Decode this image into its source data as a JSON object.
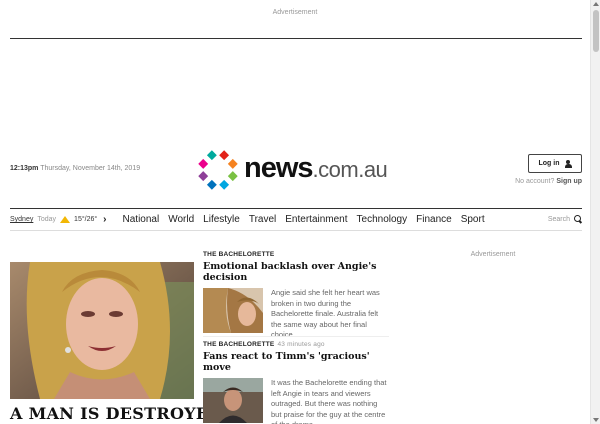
{
  "ads": {
    "top_label": "Advertisement",
    "right_label": "Advertisement"
  },
  "header": {
    "time": "12:13pm",
    "date": "Thursday, November 14th, 2019",
    "logo_main": "news",
    "logo_domain": ".com.au",
    "login_label": "Log in",
    "no_account_text": "No account?",
    "signup_label": "Sign up"
  },
  "weather": {
    "city": "Sydney",
    "day": "Today",
    "temps": "15°/26°"
  },
  "nav": {
    "items": [
      "National",
      "World",
      "Lifestyle",
      "Travel",
      "Entertainment",
      "Technology",
      "Finance",
      "Sport"
    ],
    "search_label": "Search"
  },
  "lead": {
    "title": "A MAN IS DESTROYED:"
  },
  "stories": [
    {
      "kicker": "THE BACHELORETTE",
      "ago": "",
      "headline": "Emotional backlash over Angie's decision",
      "summary": "Angie said she felt her heart was broken in two during the Bachelorette finale. Australia felt the same way about her final choice."
    },
    {
      "kicker": "THE BACHELORETTE",
      "ago": "43 minutes ago",
      "headline": "Fans react to Timm's 'gracious' move",
      "summary": "It was the Bachelorette ending that left Angie in tears and viewers outraged. But there was nothing but praise for the guy at the centre of the drama."
    }
  ],
  "colors": {
    "logo_dots": [
      "#e2231a",
      "#f58220",
      "#7ac143",
      "#00a7e1",
      "#0072bc",
      "#8e3f98",
      "#ec008c",
      "#00a99d"
    ],
    "weather_icon": "#f2b705"
  },
  "icons": {
    "user": "user-icon",
    "search": "search-icon",
    "weather": "sun-icon",
    "chevron": "chevron-right-icon"
  }
}
